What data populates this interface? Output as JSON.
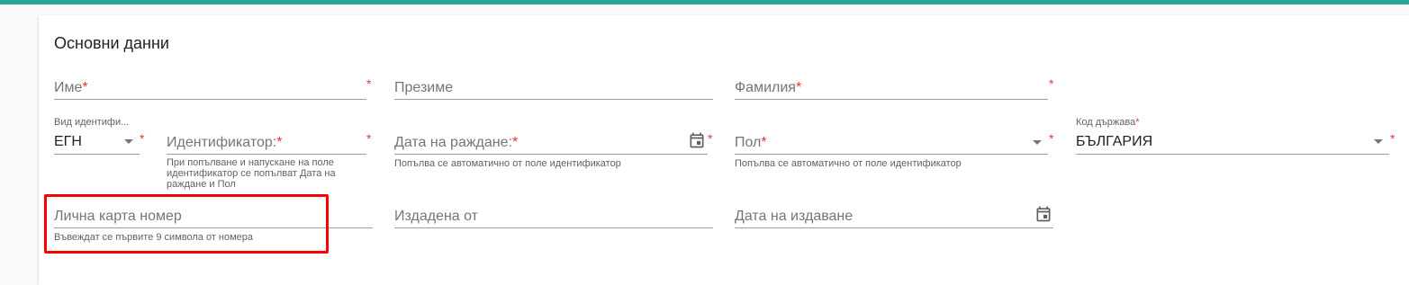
{
  "section": {
    "title": "Основни данни"
  },
  "row1": {
    "first_name": {
      "label": "Име",
      "required_mark": "*"
    },
    "middle_name": {
      "label": "Презиме"
    },
    "last_name": {
      "label": "Фамилия",
      "required_mark": "*"
    }
  },
  "row2": {
    "id_type": {
      "label": "Вид идентифи...",
      "value": "ЕГН",
      "required_mark": "*"
    },
    "identifier": {
      "label": "Идентификатор:",
      "required_mark": "*",
      "hint": "При попълване и напускане на поле идентификатор се попълват Дата на раждане и Пол"
    },
    "birth_date": {
      "label": "Дата на раждане:",
      "required_mark": "*",
      "hint": "Попълва се автоматично от поле идентификатор",
      "icon": "calendar-icon"
    },
    "gender": {
      "label": "Пол",
      "required_mark": "*",
      "hint": "Попълва се автоматично от поле идентификатор"
    },
    "country_code": {
      "label": "Код държава",
      "value": "БЪЛГАРИЯ",
      "required_mark": "*"
    }
  },
  "row3": {
    "id_card_number": {
      "label": "Лична карта номер",
      "hint": "Въвеждат се първите 9 символа от номера"
    },
    "issued_by": {
      "label": "Издадена от"
    },
    "issue_date": {
      "label": "Дата на издаване",
      "icon": "calendar-icon"
    }
  },
  "colors": {
    "accent": "#26a69a",
    "required": "#e53935",
    "highlight": "#ff0000"
  }
}
